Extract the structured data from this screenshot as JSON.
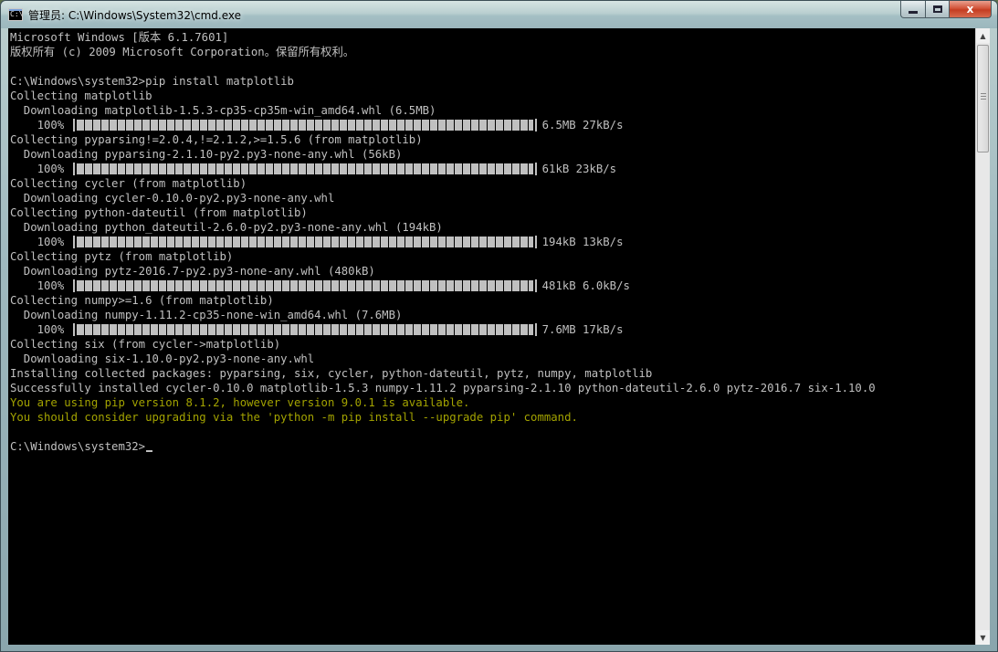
{
  "window": {
    "title": "管理员: C:\\Windows\\System32\\cmd.exe",
    "app_icon": "cmd-prompt-icon",
    "buttons": {
      "minimize": "minimize-icon",
      "maximize": "maximize-icon",
      "close_label": "x"
    }
  },
  "colors": {
    "console_bg": "#000000",
    "console_fg": "#c0c0c0",
    "warning_fg": "#a3a300"
  },
  "console": {
    "lines": [
      {
        "type": "text",
        "text": "Microsoft Windows [版本 6.1.7601]"
      },
      {
        "type": "text",
        "text": "版权所有 (c) 2009 Microsoft Corporation。保留所有权利。"
      },
      {
        "type": "text",
        "text": ""
      },
      {
        "type": "text",
        "text": "C:\\Windows\\system32>pip install matplotlib"
      },
      {
        "type": "text",
        "text": "Collecting matplotlib"
      },
      {
        "type": "text",
        "text": "  Downloading matplotlib-1.5.3-cp35-cp35m-win_amd64.whl (6.5MB)"
      },
      {
        "type": "progress",
        "percent_label": "    100% ",
        "progress": 1.0,
        "stats": "6.5MB 27kB/s"
      },
      {
        "type": "text",
        "text": "Collecting pyparsing!=2.0.4,!=2.1.2,>=1.5.6 (from matplotlib)"
      },
      {
        "type": "text",
        "text": "  Downloading pyparsing-2.1.10-py2.py3-none-any.whl (56kB)"
      },
      {
        "type": "progress",
        "percent_label": "    100% ",
        "progress": 1.0,
        "stats": "61kB 23kB/s"
      },
      {
        "type": "text",
        "text": "Collecting cycler (from matplotlib)"
      },
      {
        "type": "text",
        "text": "  Downloading cycler-0.10.0-py2.py3-none-any.whl"
      },
      {
        "type": "text",
        "text": "Collecting python-dateutil (from matplotlib)"
      },
      {
        "type": "text",
        "text": "  Downloading python_dateutil-2.6.0-py2.py3-none-any.whl (194kB)"
      },
      {
        "type": "progress",
        "percent_label": "    100% ",
        "progress": 1.0,
        "stats": "194kB 13kB/s"
      },
      {
        "type": "text",
        "text": "Collecting pytz (from matplotlib)"
      },
      {
        "type": "text",
        "text": "  Downloading pytz-2016.7-py2.py3-none-any.whl (480kB)"
      },
      {
        "type": "progress",
        "percent_label": "    100% ",
        "progress": 1.0,
        "stats": "481kB 6.0kB/s"
      },
      {
        "type": "text",
        "text": "Collecting numpy>=1.6 (from matplotlib)"
      },
      {
        "type": "text",
        "text": "  Downloading numpy-1.11.2-cp35-none-win_amd64.whl (7.6MB)"
      },
      {
        "type": "progress",
        "percent_label": "    100% ",
        "progress": 1.0,
        "stats": "7.6MB 17kB/s"
      },
      {
        "type": "text",
        "text": "Collecting six (from cycler->matplotlib)"
      },
      {
        "type": "text",
        "text": "  Downloading six-1.10.0-py2.py3-none-any.whl"
      },
      {
        "type": "text",
        "text": "Installing collected packages: pyparsing, six, cycler, python-dateutil, pytz, numpy, matplotlib"
      },
      {
        "type": "text",
        "text": "Successfully installed cycler-0.10.0 matplotlib-1.5.3 numpy-1.11.2 pyparsing-2.1.10 python-dateutil-2.6.0 pytz-2016.7 six-1.10.0"
      },
      {
        "type": "warning",
        "text": "You are using pip version 8.1.2, however version 9.0.1 is available."
      },
      {
        "type": "warning",
        "text": "You should consider upgrading via the 'python -m pip install --upgrade pip' command."
      },
      {
        "type": "text",
        "text": ""
      },
      {
        "type": "prompt",
        "text": "C:\\Windows\\system32>"
      }
    ]
  },
  "scrollbar": {
    "up_icon": "scroll-up-arrow-icon",
    "down_icon": "scroll-down-arrow-icon",
    "up_glyph": "▲",
    "down_glyph": "▼"
  }
}
